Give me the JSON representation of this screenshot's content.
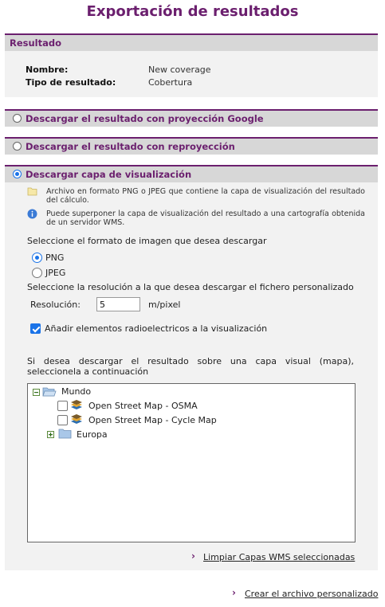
{
  "page": {
    "title": "Exportación de resultados"
  },
  "result_section": {
    "header": "Resultado",
    "name_label": "Nombre:",
    "name_value": "New coverage",
    "type_label": "Tipo de resultado:",
    "type_value": "Cobertura"
  },
  "options": {
    "google": {
      "label": "Descargar el resultado con proyección Google",
      "selected": false
    },
    "reproject": {
      "label": "Descargar el resultado con reproyección",
      "selected": false
    },
    "visual_layer": {
      "label": "Descargar capa de visualización",
      "selected": true
    }
  },
  "visual_layer": {
    "note1": "Archivo en formato PNG o JPEG que contiene la capa de visualización del resultado del cálculo.",
    "note2": "Puede superponer la capa de visualización del resultado a una cartografía obtenida de un servidor WMS.",
    "format_prompt": "Seleccione el formato de imagen que desea descargar",
    "formats": [
      {
        "label": "PNG",
        "selected": true
      },
      {
        "label": "JPEG",
        "selected": false
      }
    ],
    "resolution_prompt": "Seleccione la resolución a la que desea descargar el fichero personalizado",
    "resolution_label": "Resolución:",
    "resolution_value": "5",
    "resolution_unit": "m/pixel",
    "radio_elements_label": "Añadir elementos radioelectricos a la visualización",
    "radio_elements_checked": true,
    "wms_prompt": "Si desea descargar el resultado sobre una capa visual (mapa), seleccionela a continuación",
    "tree": {
      "root": "Mundo",
      "children": [
        {
          "label": "Open Street Map - OSMA",
          "checked": false
        },
        {
          "label": "Open Street Map - Cycle Map",
          "checked": false
        }
      ],
      "sibling": "Europa"
    },
    "clear_link": "Limpiar Capas WMS seleccionadas"
  },
  "footer": {
    "create_link": "Crear el archivo personalizado"
  },
  "colors": {
    "accent": "#6b1f6e",
    "radio": "#1a73e8",
    "header_bg": "#d7d7d7",
    "panel_bg": "#f2f2f2"
  }
}
